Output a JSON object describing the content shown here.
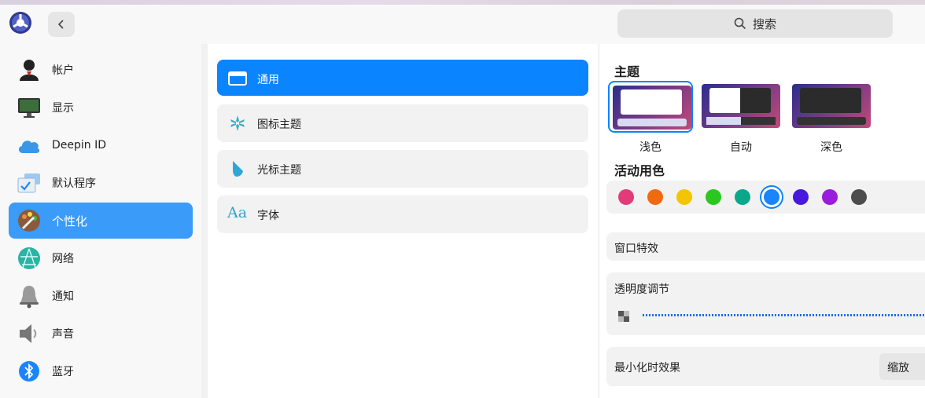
{
  "header": {
    "search_label": "搜索"
  },
  "sidebar": {
    "items": [
      {
        "label": "帐户",
        "icon": "account-icon"
      },
      {
        "label": "显示",
        "icon": "display-icon"
      },
      {
        "label": "Deepin ID",
        "icon": "cloud-icon"
      },
      {
        "label": "默认程序",
        "icon": "default-apps-icon"
      },
      {
        "label": "个性化",
        "icon": "personalization-icon",
        "active": true
      },
      {
        "label": "网络",
        "icon": "network-icon"
      },
      {
        "label": "通知",
        "icon": "bell-icon"
      },
      {
        "label": "声音",
        "icon": "speaker-icon"
      },
      {
        "label": "蓝牙",
        "icon": "bluetooth-icon"
      }
    ]
  },
  "middle": {
    "items": [
      {
        "label": "通用",
        "icon": "window-icon",
        "active": true
      },
      {
        "label": "图标主题",
        "icon": "icon-theme-icon"
      },
      {
        "label": "光标主题",
        "icon": "cursor-icon"
      },
      {
        "label": "字体",
        "icon": "font-icon"
      }
    ]
  },
  "right": {
    "theme_title": "主题",
    "themes": [
      {
        "label": "浅色",
        "selected": true
      },
      {
        "label": "自动"
      },
      {
        "label": "深色"
      }
    ],
    "accent_title": "活动用色",
    "accent_colors": [
      "#e23b7a",
      "#f26a10",
      "#f5c400",
      "#2bc721",
      "#0aa88a",
      "#1a84ff",
      "#4818dc",
      "#9a1cdc",
      "#4d4d4d"
    ],
    "accent_selected_index": 5,
    "window_effects_label": "窗口特效",
    "transparency_label": "透明度调节",
    "minimize_label": "最小化时效果",
    "minimize_value": "缩放",
    "font_icon_text": "Aa"
  }
}
